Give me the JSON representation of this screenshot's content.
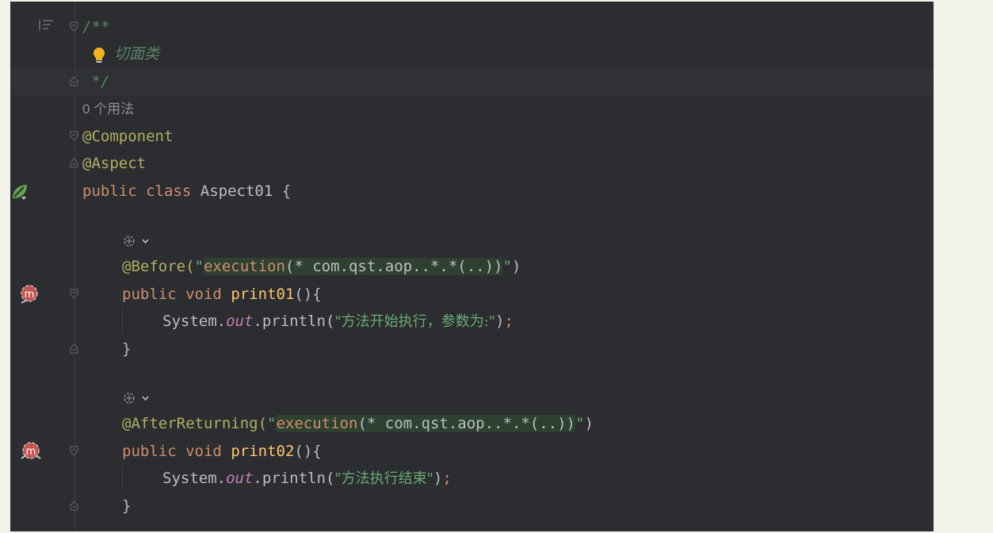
{
  "editor": {
    "lines": {
      "l1": "/**",
      "l2": "切面类",
      "l3": "*/",
      "usage": "0 个用法",
      "ann_component": "@Component",
      "ann_aspect": "@Aspect",
      "class_public": "public",
      "class_kw": "class",
      "class_name": "Aspect01 {",
      "before_ann": "@Before(",
      "before_q1": "\"",
      "before_exec": "execution",
      "before_args": "(* com.qst.aop..*.*(..))",
      "before_q2": "\"",
      "before_close": ")",
      "m1_public": "public",
      "m1_void": "void",
      "m1_name": "print01",
      "m1_tail": "(){",
      "m1_sys": "System.",
      "m1_out": "out",
      "m1_println": ".println(",
      "m1_str": "\"方法开始执行，参数为:\"",
      "m1_close": ")",
      "m1_semi": ";",
      "m1_brace": "}",
      "after_ann": "@AfterReturning(",
      "after_q1": "\"",
      "after_exec": "execution",
      "after_args": "(* com.qst.aop..*.*(..))",
      "after_q2": "\"",
      "after_close": ")",
      "m2_public": "public",
      "m2_void": "void",
      "m2_name": "print02",
      "m2_tail": "(){",
      "m2_sys": "System.",
      "m2_out": "out",
      "m2_println": ".println(",
      "m2_str": "\"方法执行结束\"",
      "m2_close": ")",
      "m2_semi": ";",
      "m2_brace": "}"
    },
    "icons": {
      "structure": "structure-list-icon",
      "hint": "lightbulb-icon",
      "spring_bean": "spring-bean-icon",
      "advice_before": "aop-advice-icon",
      "advice_after": "aop-advice-icon",
      "inlay": "inlay-hint-icon"
    }
  },
  "colors": {
    "background": "#2b2d30",
    "keyword": "#cf8e6d",
    "annotation": "#b3ae60",
    "string": "#6aab73",
    "comment": "#5f826b",
    "static_field": "#c77dbb",
    "method": "#56a8f5"
  }
}
